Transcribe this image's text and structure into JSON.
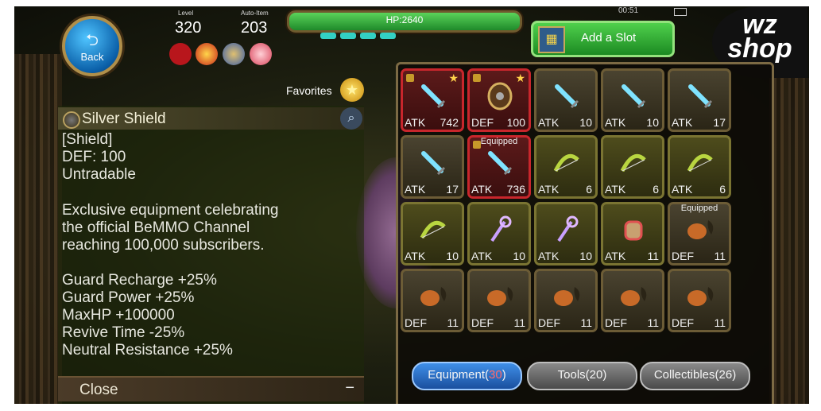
{
  "top": {
    "back_label": "Back",
    "level_label": "Level",
    "level": "320",
    "auto_item_label": "Auto-Item",
    "auto_item": "203",
    "hp": "HP:2640",
    "add_slot_label": "Add a Slot",
    "clock": "00:51",
    "logo_line1": "wz",
    "logo_line2": "shop"
  },
  "favorites_label": "Favorites",
  "item": {
    "name": "Silver Shield",
    "type": "[Shield]",
    "def_line": "DEF: 100",
    "trade": "Untradable",
    "description": "Exclusive equipment celebrating\nthe official BeMMO Channel\nreaching 100,000 subscribers.",
    "stats": "Guard Recharge +25%\nGuard Power +25%\nMaxHP +100000\nRevive Time -25%\nNeutral Resistance +25%"
  },
  "close_label": "Close",
  "close_minus": "−",
  "tabs": {
    "equipment": "Equipment(",
    "equipment_count": "30",
    "equipment_close": ")",
    "tools": "Tools(20)",
    "collectibles": "Collectibles(26)"
  },
  "inventory": [
    {
      "stat": "ATK",
      "value": "742",
      "icon": "sword-icon",
      "style": "red",
      "lock": true,
      "star": true,
      "equipped": ""
    },
    {
      "stat": "DEF",
      "value": "100",
      "icon": "shield-icon",
      "style": "red",
      "lock": true,
      "star": true,
      "equipped": ""
    },
    {
      "stat": "ATK",
      "value": "10",
      "icon": "sword-icon",
      "style": "normal",
      "lock": false,
      "star": false,
      "equipped": ""
    },
    {
      "stat": "ATK",
      "value": "10",
      "icon": "sword-icon",
      "style": "normal",
      "lock": false,
      "star": false,
      "equipped": ""
    },
    {
      "stat": "ATK",
      "value": "17",
      "icon": "sword-icon",
      "style": "normal",
      "lock": false,
      "star": false,
      "equipped": ""
    },
    {
      "stat": "ATK",
      "value": "17",
      "icon": "sword-icon",
      "style": "normal",
      "lock": false,
      "star": false,
      "equipped": ""
    },
    {
      "stat": "ATK",
      "value": "736",
      "icon": "sword-icon",
      "style": "red",
      "lock": true,
      "star": false,
      "equipped": "Equipped"
    },
    {
      "stat": "ATK",
      "value": "6",
      "icon": "bow-icon",
      "style": "olive",
      "lock": false,
      "star": false,
      "equipped": ""
    },
    {
      "stat": "ATK",
      "value": "6",
      "icon": "bow-icon",
      "style": "olive",
      "lock": false,
      "star": false,
      "equipped": ""
    },
    {
      "stat": "ATK",
      "value": "6",
      "icon": "bow-icon",
      "style": "olive",
      "lock": false,
      "star": false,
      "equipped": ""
    },
    {
      "stat": "ATK",
      "value": "10",
      "icon": "bow-icon",
      "style": "olive",
      "lock": false,
      "star": false,
      "equipped": ""
    },
    {
      "stat": "ATK",
      "value": "10",
      "icon": "staff-icon",
      "style": "olive",
      "lock": false,
      "star": false,
      "equipped": ""
    },
    {
      "stat": "ATK",
      "value": "10",
      "icon": "staff-icon",
      "style": "olive",
      "lock": false,
      "star": false,
      "equipped": ""
    },
    {
      "stat": "ATK",
      "value": "11",
      "icon": "gauntlet-icon",
      "style": "olive",
      "lock": false,
      "star": false,
      "equipped": ""
    },
    {
      "stat": "DEF",
      "value": "11",
      "icon": "armor-icon",
      "style": "normal",
      "lock": false,
      "star": false,
      "equipped": "Equipped"
    },
    {
      "stat": "DEF",
      "value": "11",
      "icon": "armor-icon",
      "style": "normal",
      "lock": false,
      "star": false,
      "equipped": ""
    },
    {
      "stat": "DEF",
      "value": "11",
      "icon": "armor-icon",
      "style": "normal",
      "lock": false,
      "star": false,
      "equipped": ""
    },
    {
      "stat": "DEF",
      "value": "11",
      "icon": "armor-icon",
      "style": "normal",
      "lock": false,
      "star": false,
      "equipped": ""
    },
    {
      "stat": "DEF",
      "value": "11",
      "icon": "armor-icon",
      "style": "normal",
      "lock": false,
      "star": false,
      "equipped": ""
    },
    {
      "stat": "DEF",
      "value": "11",
      "icon": "armor-icon",
      "style": "normal",
      "lock": false,
      "star": false,
      "equipped": ""
    }
  ]
}
